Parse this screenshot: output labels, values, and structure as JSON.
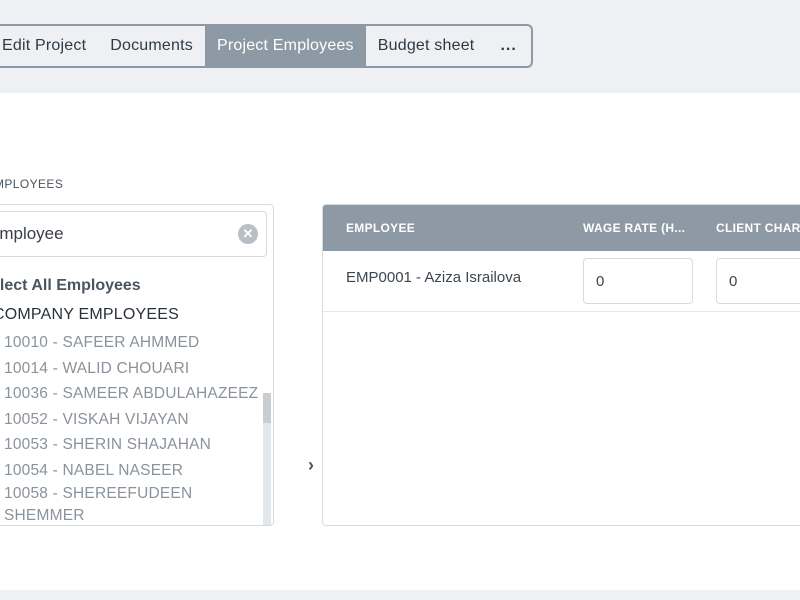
{
  "tabs": [
    {
      "label": "Edit Project",
      "active": false
    },
    {
      "label": "Documents",
      "active": false
    },
    {
      "label": "Project Employees",
      "active": true
    },
    {
      "label": "Budget sheet",
      "active": false
    },
    {
      "label": "...",
      "active": false
    }
  ],
  "section_label": "MPLOYEES",
  "search": {
    "placeholder": "Employee",
    "value": ""
  },
  "select_all_label": "elect All Employees",
  "group_title": "COMPANY EMPLOYEES",
  "employees": [
    "10010 - SAFEER AHMMED",
    "10014 - WALID CHOUARI",
    "10036 - SAMEER ABDULAHAZEEZ",
    "10052 - VISKAH VIJAYAN",
    "10053 - SHERIN SHAJAHAN",
    "10054 - NABEL NASEER",
    "10058 - SHEREEFUDEEN SHEMMER"
  ],
  "transfer_arrow": "›",
  "table": {
    "headers": [
      "EMPLOYEE",
      "WAGE RATE (H...",
      "CLIENT CHAR"
    ],
    "rows": [
      {
        "employee": "EMP0001 - Aziza Israilova",
        "wage_rate": "0",
        "client_charge": "0"
      }
    ]
  },
  "colors": {
    "accent": "#8e99a6",
    "panel": "#ffffff",
    "background": "#eef0f3"
  }
}
